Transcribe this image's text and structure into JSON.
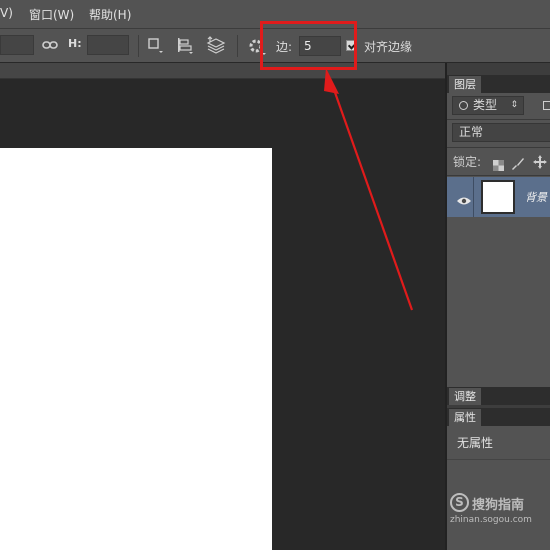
{
  "menubar": {
    "items": [
      {
        "label": "V)"
      },
      {
        "label": "窗口(W)"
      },
      {
        "label": "帮助(H)"
      }
    ]
  },
  "options": {
    "h_label": "H:",
    "edge_label": "边:",
    "edge_value": "5",
    "align_edges_label": "对齐边缘",
    "align_edges_checked": true
  },
  "layers_panel": {
    "tab": "图层",
    "filter_label": "类型",
    "blend_mode": "正常",
    "lock_label": "锁定:",
    "layers": [
      {
        "name": "背景",
        "visible": true
      }
    ]
  },
  "adjust_panel": {
    "tab": "调整"
  },
  "properties_panel": {
    "tab": "属性",
    "empty_text": "无属性"
  },
  "watermark": {
    "logo": "S",
    "text": "搜狗指南",
    "url": "zhinan.sogou.com"
  },
  "colors": {
    "annotation": "#e01b1b",
    "layer_selected": "#5b6f8c"
  }
}
